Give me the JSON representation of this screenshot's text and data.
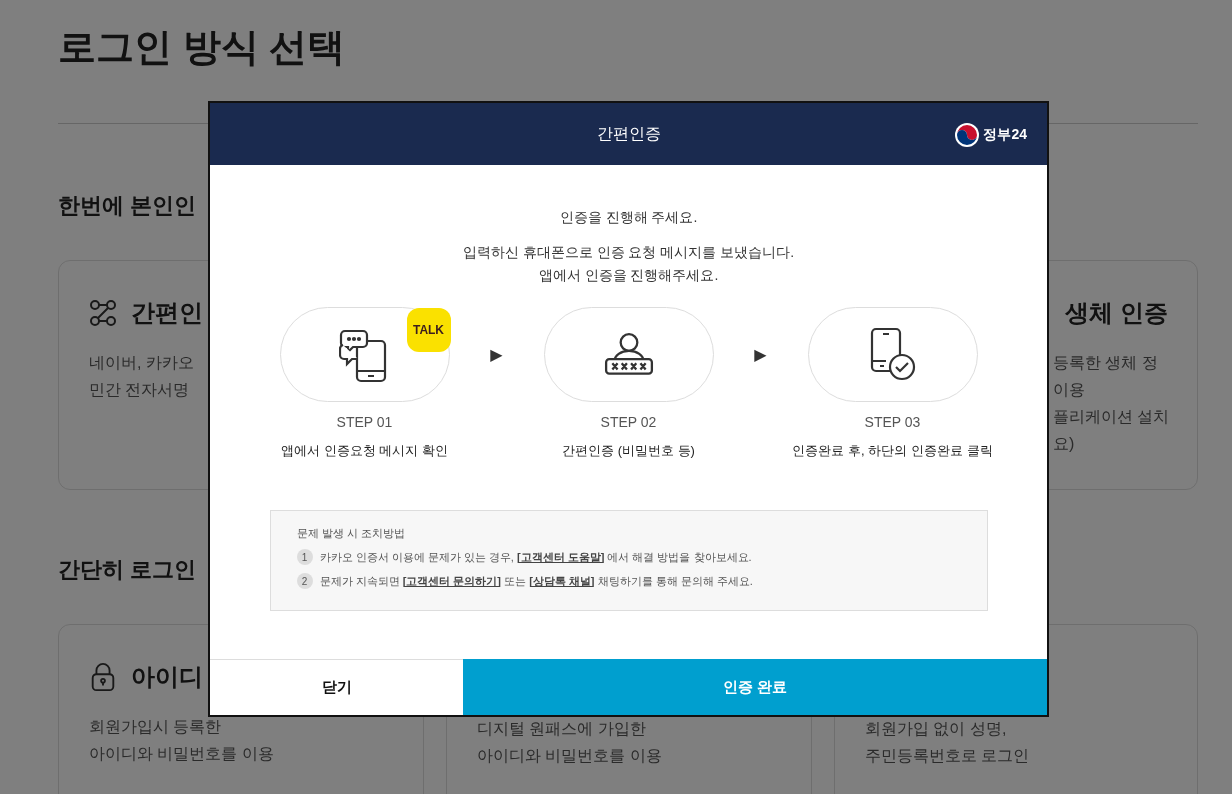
{
  "page_title": "로그인 방식 선택",
  "section_1": {
    "heading": "한번에 본인인",
    "cards": [
      {
        "title": "간편인",
        "lines": [
          "네이버, 카카오",
          "민간 전자서명"
        ]
      },
      {
        "title": "생체 인증",
        "lines": [
          "등록한 생체 정",
          "이용",
          "플리케이션 설치",
          "요)"
        ]
      }
    ]
  },
  "section_2": {
    "heading": "간단히 로그인",
    "cards": [
      {
        "title": "아이디",
        "lines": [
          "회원가입시 등록한",
          "아이디와 비밀번호를 이용"
        ]
      },
      {
        "lines": [
          "디지털 원패스에 가입한",
          "아이디와 비밀번호를 이용"
        ]
      },
      {
        "lines": [
          "회원가입 없이 성명,",
          "주민등록번호로 로그인"
        ]
      }
    ]
  },
  "modal": {
    "title": "간편인증",
    "logo": "정부24",
    "intro": "인증을 진행해 주세요.",
    "message": [
      "입력하신 휴대폰으로 인증 요청 메시지를 보냈습니다.",
      "앱에서 인증을 진행해주세요."
    ],
    "steps": [
      {
        "badge": "TALK",
        "label": "STEP 01",
        "desc": "앱에서 인증요청 메시지 확인"
      },
      {
        "label": "STEP 02",
        "desc": "간편인증 (비밀번호 등)"
      },
      {
        "label": "STEP 03",
        "desc": "인증완료 후, 하단의 인증완료 클릭"
      }
    ],
    "arrow": "▶",
    "help": {
      "title": "문제 발생 시 조치방법",
      "items": [
        {
          "number": "1",
          "parts": [
            {
              "kind": "text",
              "text": "카카오 인증서 이용에 문제가 있는 경우, "
            },
            {
              "kind": "link",
              "text": "[고객센터 도움말]"
            },
            {
              "kind": "text",
              "text": " 에서 해결 방법을 찾아보세요."
            }
          ]
        },
        {
          "number": "2",
          "parts": [
            {
              "kind": "text",
              "text": "문제가 지속되면 "
            },
            {
              "kind": "link",
              "text": "[고객센터 문의하기]"
            },
            {
              "kind": "text",
              "text": " 또는 "
            },
            {
              "kind": "link",
              "text": "[상담톡 채널]"
            },
            {
              "kind": "text",
              "text": " 채팅하기를 통해 문의해 주세요."
            }
          ]
        }
      ]
    },
    "buttons": [
      {
        "kind": "secondary",
        "label": "닫기"
      },
      {
        "kind": "primary",
        "label": "인증 완료"
      }
    ]
  }
}
